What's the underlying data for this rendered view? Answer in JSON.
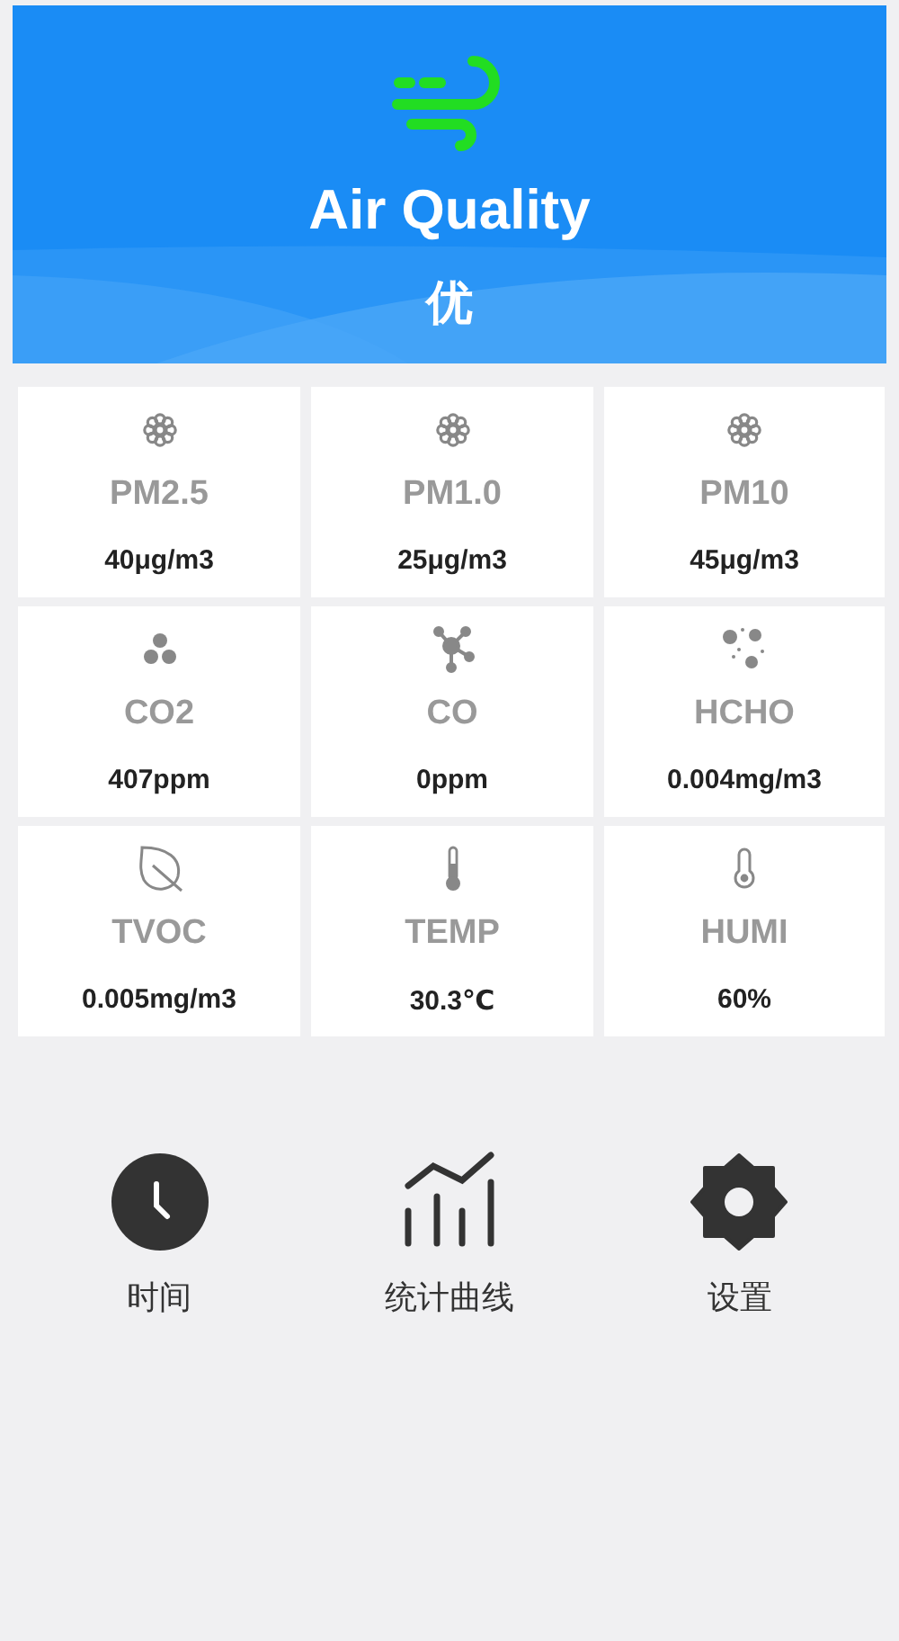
{
  "header": {
    "title": "Air Quality",
    "grade": "优"
  },
  "sensors": [
    {
      "name": "PM2.5",
      "value": "40μg/m3"
    },
    {
      "name": "PM1.0",
      "value": "25μg/m3"
    },
    {
      "name": "PM10",
      "value": "45μg/m3"
    },
    {
      "name": "CO2",
      "value": "407ppm"
    },
    {
      "name": "CO",
      "value": "0ppm"
    },
    {
      "name": "HCHO",
      "value": "0.004mg/m3"
    },
    {
      "name": "TVOC",
      "value": "0.005mg/m3"
    },
    {
      "name": "TEMP",
      "value": "30.3℃"
    },
    {
      "name": "HUMI",
      "value": "60%"
    }
  ],
  "actions": [
    {
      "label": "时间"
    },
    {
      "label": "统计曲线"
    },
    {
      "label": "设置"
    }
  ]
}
